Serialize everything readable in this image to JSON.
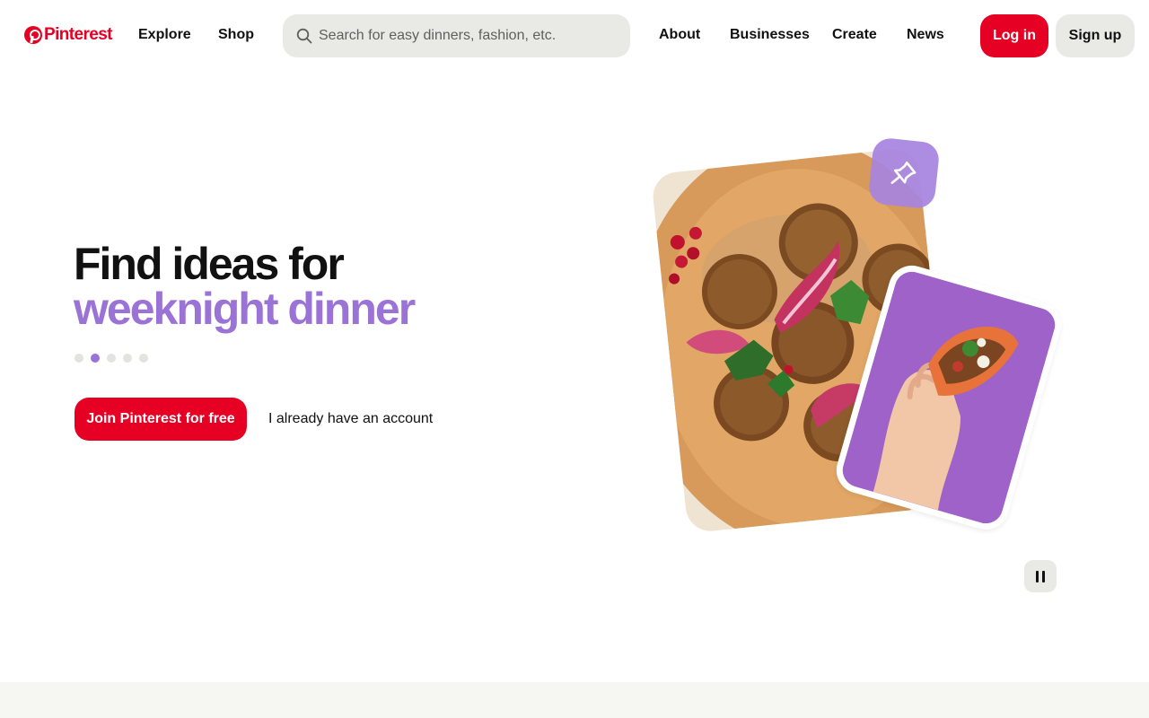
{
  "header": {
    "logo_text": "Pinterest",
    "nav_left": [
      "Explore",
      "Shop"
    ],
    "search": {
      "placeholder": "Search for easy dinners, fashion, etc."
    },
    "nav_right": [
      "About",
      "Businesses",
      "Create",
      "News"
    ],
    "login_label": "Log in",
    "signup_label": "Sign up"
  },
  "hero": {
    "headline": "Find ideas for",
    "headline_accent": "weeknight dinner",
    "accent_color": "#9b72d6",
    "carousel": {
      "slides": 5,
      "active_index": 1
    },
    "join_label": "Join Pinterest for free",
    "account_link": "I already have an account"
  },
  "colors": {
    "brand": "#e60023",
    "search_bg": "#e9e9e5",
    "accent": "#9b72d6"
  },
  "icons": [
    "pinterest-logo-icon",
    "search-icon",
    "pin-icon",
    "pause-icon"
  ]
}
